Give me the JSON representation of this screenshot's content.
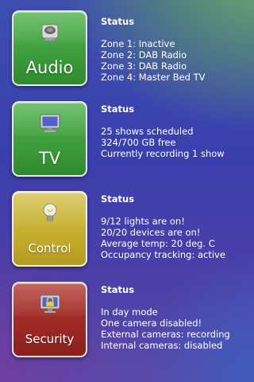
{
  "zones": [
    {
      "button_label": "Audio",
      "icon": "speaker-icon",
      "status_title": "Status",
      "lines": [
        "Zone 1: Inactive",
        "Zone 2: DAB Radio",
        "Zone 3: DAB Radio",
        "Zone 4: Master Bed TV"
      ]
    },
    {
      "button_label": "TV",
      "icon": "monitor-icon",
      "status_title": "Status",
      "lines": [
        "25 shows scheduled",
        "324/700 GB free",
        "Currently recording 1 show"
      ]
    },
    {
      "button_label": "Control",
      "icon": "lightbulb-icon",
      "status_title": "Status",
      "lines": [
        "9/12 lights are on!",
        "20/20 devices are on!",
        "Average temp: 20 deg. C",
        "Occupancy tracking: active"
      ]
    },
    {
      "button_label": "Security",
      "icon": "lock-monitor-icon",
      "status_title": "Status",
      "lines": [
        "In day mode",
        "One camera disabled!",
        "External cameras: recording",
        "Internal cameras: disabled"
      ]
    }
  ],
  "colors": {
    "green": "#3e9e3c",
    "yellow": "#c6ae2f",
    "red": "#9e2a25"
  }
}
